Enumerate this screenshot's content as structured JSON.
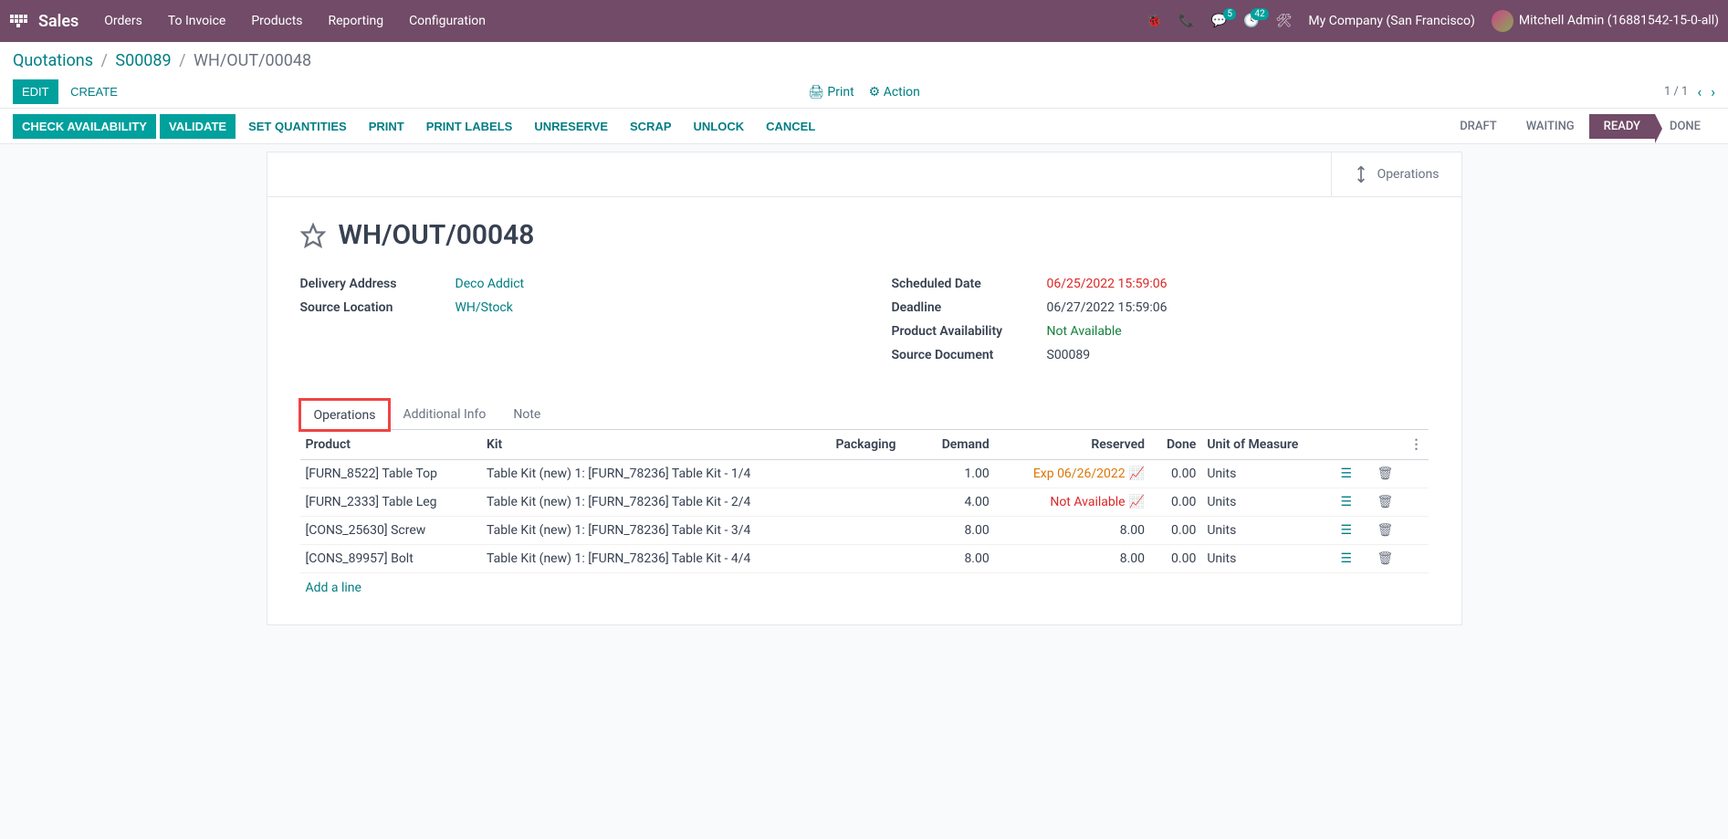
{
  "topbar": {
    "brand": "Sales",
    "menu": [
      "Orders",
      "To Invoice",
      "Products",
      "Reporting",
      "Configuration"
    ],
    "msg_badge": "5",
    "activity_badge": "42",
    "company": "My Company (San Francisco)",
    "user": "Mitchell Admin (16881542-15-0-all)"
  },
  "breadcrumb": {
    "root": "Quotations",
    "parent": "S00089",
    "current": "WH/OUT/00048"
  },
  "actions": {
    "edit": "EDIT",
    "create": "CREATE",
    "print": "Print",
    "action": "Action",
    "pager": "1 / 1"
  },
  "statusbar": {
    "buttons": [
      "CHECK AVAILABILITY",
      "VALIDATE",
      "SET QUANTITIES",
      "PRINT",
      "PRINT LABELS",
      "UNRESERVE",
      "SCRAP",
      "UNLOCK",
      "CANCEL"
    ],
    "stages": [
      "DRAFT",
      "WAITING",
      "READY",
      "DONE"
    ],
    "active_stage": 2
  },
  "ops_button": "Operations",
  "record": {
    "title": "WH/OUT/00048",
    "delivery_address_label": "Delivery Address",
    "delivery_address": "Deco Addict",
    "source_location_label": "Source Location",
    "source_location": "WH/Stock",
    "scheduled_date_label": "Scheduled Date",
    "scheduled_date": "06/25/2022 15:59:06",
    "deadline_label": "Deadline",
    "deadline": "06/27/2022 15:59:06",
    "availability_label": "Product Availability",
    "availability": "Not Available",
    "source_doc_label": "Source Document",
    "source_doc": "S00089"
  },
  "tabs": [
    "Operations",
    "Additional Info",
    "Note"
  ],
  "table": {
    "headers": {
      "product": "Product",
      "kit": "Kit",
      "packaging": "Packaging",
      "demand": "Demand",
      "reserved": "Reserved",
      "done": "Done",
      "uom": "Unit of Measure"
    },
    "rows": [
      {
        "product": "[FURN_8522] Table Top",
        "kit": "Table Kit (new) 1: [FURN_78236] Table Kit - 1/4",
        "packaging": "",
        "demand": "1.00",
        "reserved": "Exp 06/26/2022",
        "reserved_class": "reserved-orange",
        "forecast": "green",
        "done": "0.00",
        "uom": "Units"
      },
      {
        "product": "[FURN_2333] Table Leg",
        "kit": "Table Kit (new) 1: [FURN_78236] Table Kit - 2/4",
        "packaging": "",
        "demand": "4.00",
        "reserved": "Not Available",
        "reserved_class": "reserved-red",
        "forecast": "red",
        "done": "0.00",
        "uom": "Units"
      },
      {
        "product": "[CONS_25630] Screw",
        "kit": "Table Kit (new) 1: [FURN_78236] Table Kit - 3/4",
        "packaging": "",
        "demand": "8.00",
        "reserved": "8.00",
        "reserved_class": "",
        "forecast": "",
        "done": "0.00",
        "uom": "Units"
      },
      {
        "product": "[CONS_89957] Bolt",
        "kit": "Table Kit (new) 1: [FURN_78236] Table Kit - 4/4",
        "packaging": "",
        "demand": "8.00",
        "reserved": "8.00",
        "reserved_class": "",
        "forecast": "",
        "done": "0.00",
        "uom": "Units"
      }
    ],
    "add_line": "Add a line"
  }
}
